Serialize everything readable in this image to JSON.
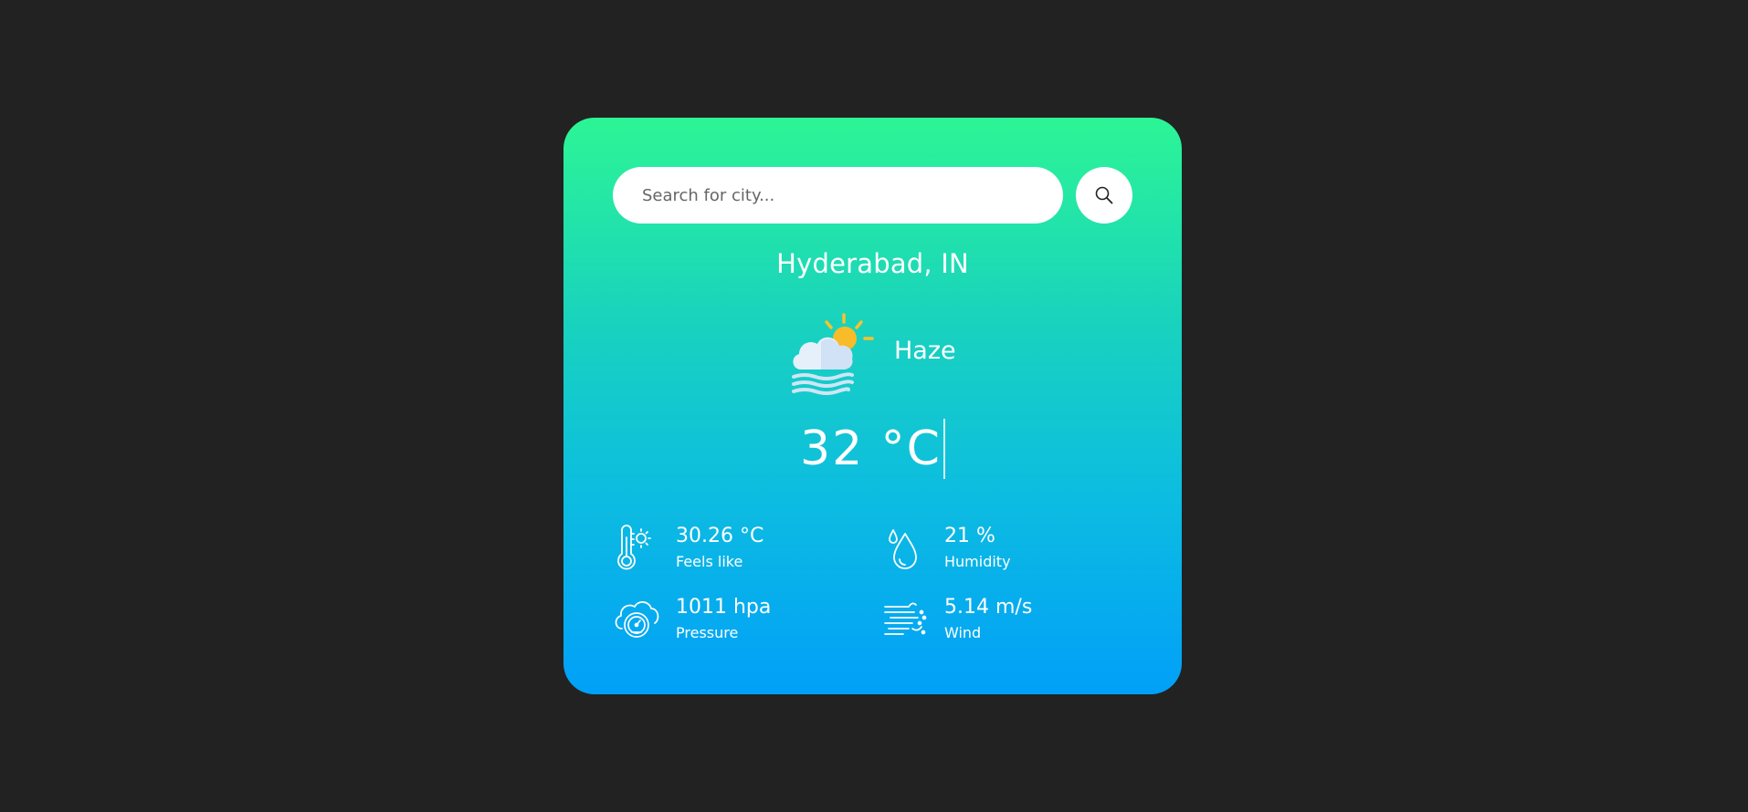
{
  "search": {
    "placeholder": "Search for city...",
    "value": ""
  },
  "location": {
    "city": "Hyderabad, IN"
  },
  "weather": {
    "condition": "Haze",
    "icon": "haze-icon",
    "temperature": "32 °C"
  },
  "details": {
    "feels_like": {
      "value": "30.26 °C",
      "label": "Feels like",
      "icon": "thermometer-icon"
    },
    "humidity": {
      "value": "21 %",
      "label": "Humidity",
      "icon": "water-drop-icon"
    },
    "pressure": {
      "value": "1011 hpa",
      "label": "Pressure",
      "icon": "pressure-gauge-icon"
    },
    "wind": {
      "value": "5.14 m/s",
      "label": "Wind",
      "icon": "wind-icon"
    }
  },
  "colors": {
    "background": "#222222",
    "gradient_top": "#2cf595",
    "gradient_bottom": "#01a0f8",
    "text": "#ffffff"
  }
}
